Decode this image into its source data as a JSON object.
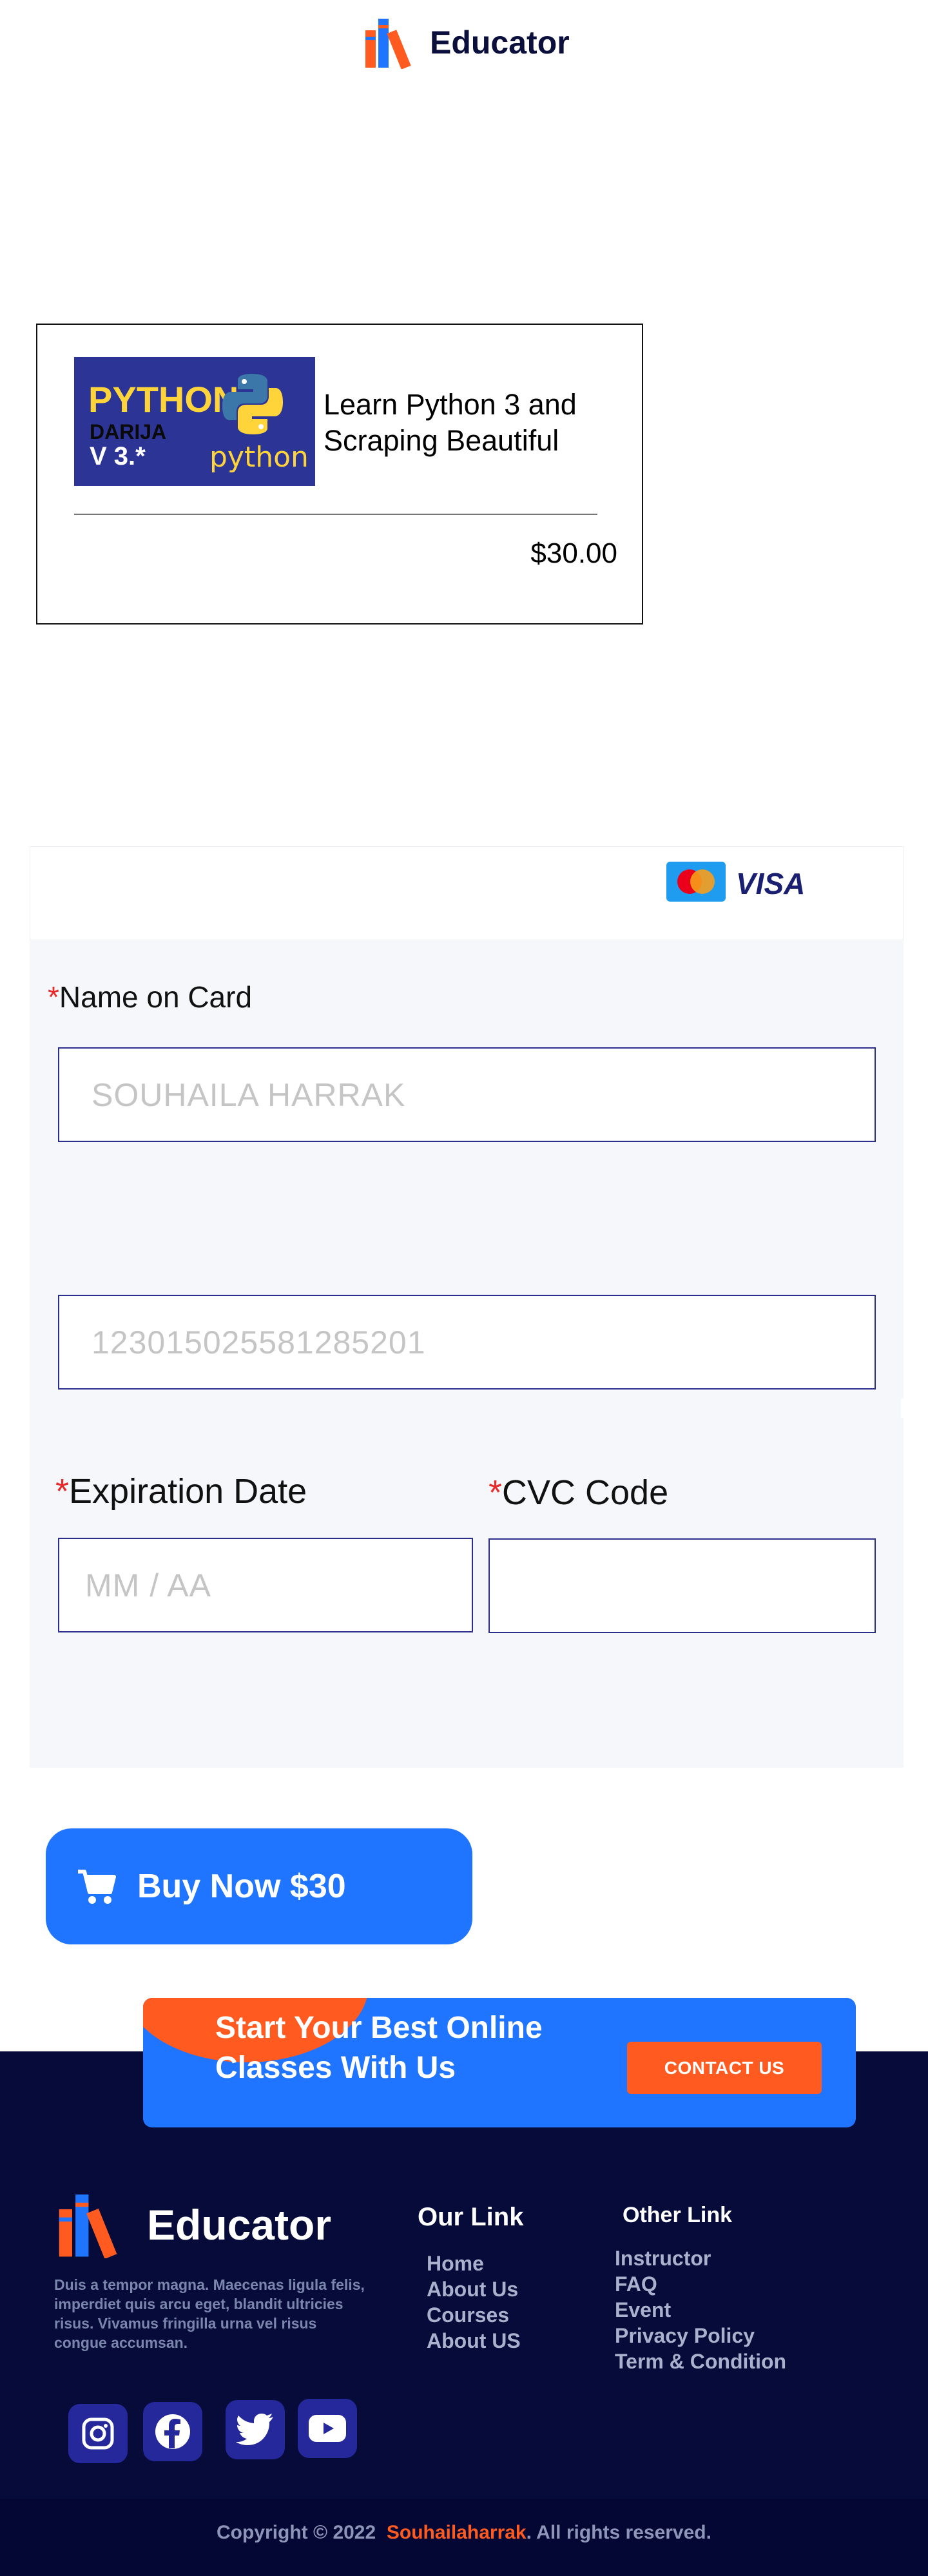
{
  "header": {
    "logo_text": "Educator"
  },
  "course": {
    "thumb_lines": [
      "PYTHON",
      "DARIJA",
      "V 3.*"
    ],
    "thumb_logo_word": "python",
    "title": "Learn Python 3 and Scraping Beautiful",
    "price": "$30.00"
  },
  "payment": {
    "card_brands": [
      "mastercard-icon",
      "VISA"
    ],
    "name_label": "Name on Card",
    "name_placeholder": "SOUHAILA HARRAK",
    "card_number_placeholder": "1230150255812852​01",
    "expiry_label": "Expiration Date",
    "expiry_placeholder": "MM / AA",
    "cvc_label": "CVC Code",
    "cvc_placeholder": "",
    "required_mark": "*"
  },
  "buy_button": {
    "label": "Buy Now $30",
    "icon": "cart-icon"
  },
  "cta": {
    "text": "Start Your Best Online Classes With Us",
    "button_label": "CONTACT US"
  },
  "footer": {
    "logo_text": "Educator",
    "description": "Duis a tempor magna. Maecenas ligula felis, imperdiet quis arcu eget,  blandit ultricies risus. Vivamus fringilla urna vel risus congue accumsan.",
    "our_link_title": "Our Link",
    "our_links": [
      "Home",
      "About Us",
      "Courses",
      "About US"
    ],
    "other_link_title": "Other Link",
    "other_links": [
      "Instructor",
      "FAQ",
      "Event",
      "Privacy Policy",
      "Term & Condition"
    ],
    "socials": [
      "instagram-icon",
      "facebook-icon",
      "twitter-icon",
      "youtube-icon"
    ],
    "copyright_prefix": "Copyright © 2022",
    "copyright_brand": "Souhailaharrak",
    "copyright_suffix": ". All rights reserved."
  },
  "colors": {
    "accent_blue": "#1f75ff",
    "accent_orange": "#ff5a1f",
    "footer_navy": "#060b3a",
    "required_red": "#e82a2a"
  }
}
